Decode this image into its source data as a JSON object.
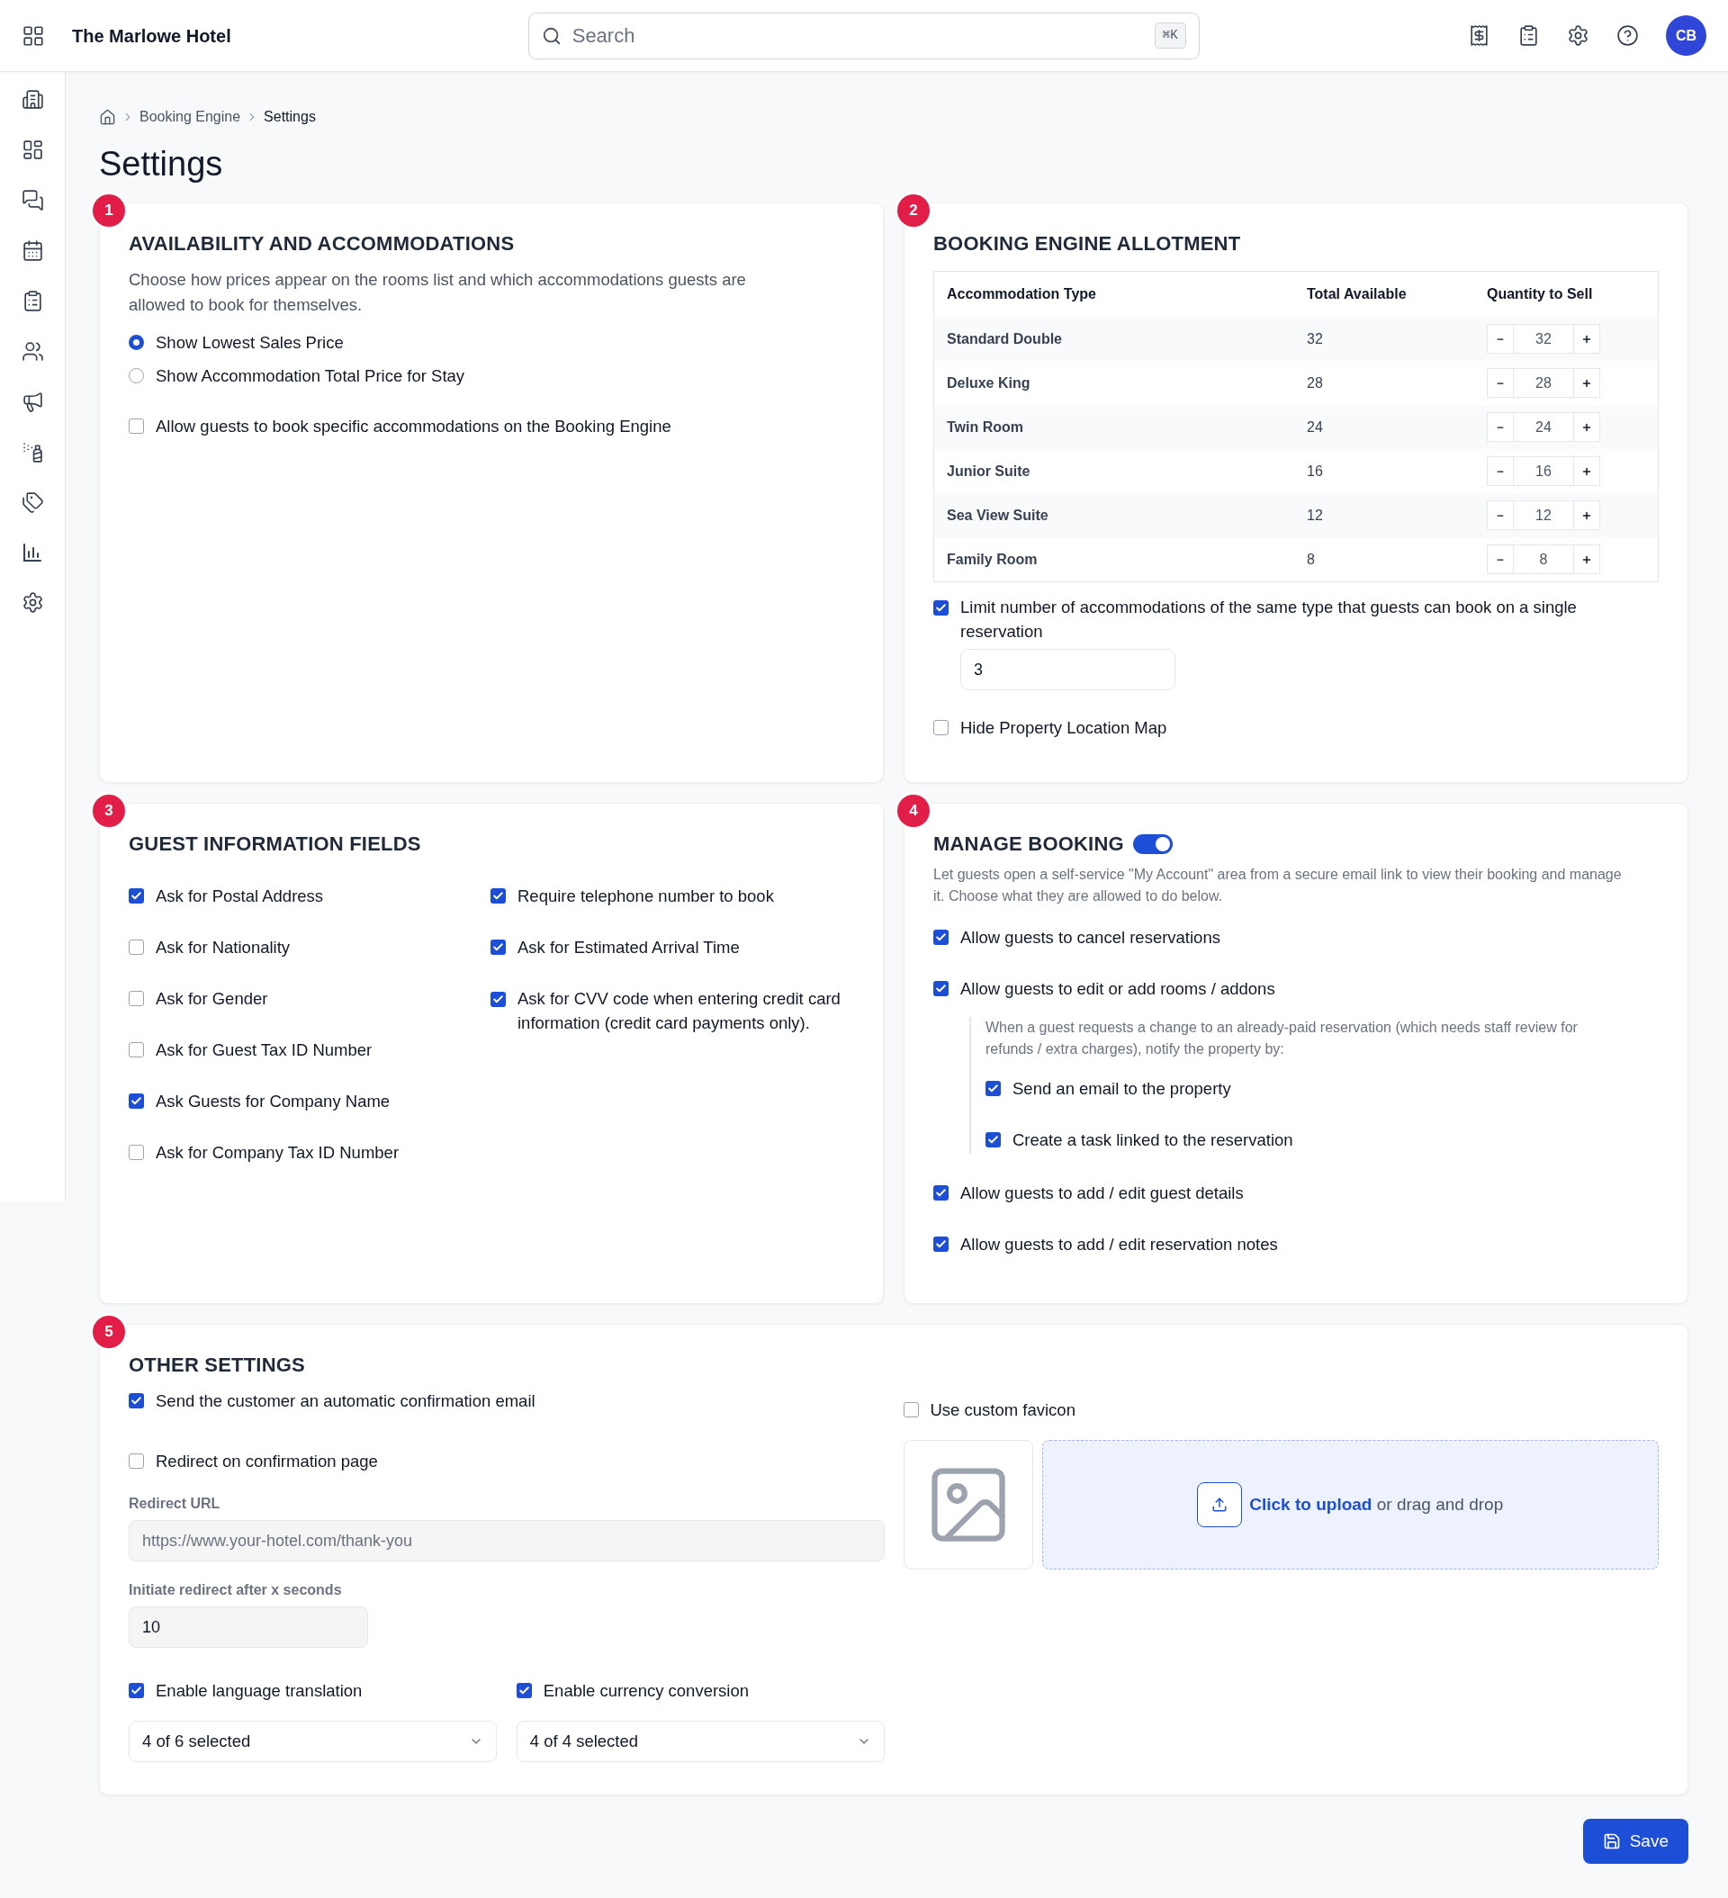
{
  "topbar": {
    "app_title": "The Marlowe Hotel",
    "search": {
      "placeholder": "Search",
      "shortcut": "⌘K"
    },
    "avatar": "CB"
  },
  "breadcrumb": [
    "Booking Engine",
    "Settings"
  ],
  "page_title": "Settings",
  "availability": {
    "number": "1",
    "title": "AVAILABILITY AND ACCOMMODATIONS",
    "description": "Choose how prices appear on the rooms list and which accommodations guests are allowed to book for themselves.",
    "price_options": [
      {
        "label": "Show Lowest Sales Price",
        "selected": true
      },
      {
        "label": "Show Accommodation Total Price for Stay",
        "selected": false
      }
    ],
    "options": [
      {
        "label": "Allow guests to book specific accommodations on the Booking Engine",
        "checked": false
      }
    ]
  },
  "allotment": {
    "number": "2",
    "title": "BOOKING ENGINE ALLOTMENT",
    "columns": [
      "Accommodation Type",
      "Total Available",
      "Quantity to Sell"
    ],
    "rows": [
      {
        "type": "Standard Double",
        "total": "32",
        "quantity": "32"
      },
      {
        "type": "Deluxe King",
        "total": "28",
        "quantity": "28"
      },
      {
        "type": "Twin Room",
        "total": "24",
        "quantity": "24"
      },
      {
        "type": "Junior Suite",
        "total": "16",
        "quantity": "16"
      },
      {
        "type": "Sea View Suite",
        "total": "12",
        "quantity": "12"
      },
      {
        "type": "Family Room",
        "total": "8",
        "quantity": "8"
      }
    ],
    "limit": {
      "label": "Limit number of accommodations of the same type that guests can book on a single reservation",
      "checked": true,
      "value": "3"
    },
    "hide_map": {
      "label": "Hide Property Location Map",
      "checked": false
    }
  },
  "guest_info": {
    "number": "3",
    "title": "GUEST INFORMATION FIELDS",
    "left": [
      {
        "label": "Ask for Postal Address",
        "checked": true
      },
      {
        "label": "Ask for Nationality",
        "checked": false
      },
      {
        "label": "Ask for Gender",
        "checked": false
      },
      {
        "label": "Ask for Guest Tax ID Number",
        "checked": false
      },
      {
        "label": "Ask Guests for Company Name",
        "checked": true
      },
      {
        "label": "Ask for Company Tax ID Number",
        "checked": false
      }
    ],
    "right": [
      {
        "label": "Require telephone number to book",
        "checked": true
      },
      {
        "label": "Ask for Estimated Arrival Time",
        "checked": true
      },
      {
        "label": "Ask for CVV code when entering credit card information (credit card payments only).",
        "checked": true
      }
    ]
  },
  "manage_booking": {
    "number": "4",
    "title": "MANAGE BOOKING",
    "enabled": true,
    "description": "Let guests open a self-service \"My Account\" area from a secure email link to view their booking and manage it. Choose what they are allowed to do below.",
    "options": [
      {
        "label": "Allow guests to cancel reservations",
        "checked": true
      },
      {
        "label": "Allow guests to edit or add rooms / addons",
        "checked": true,
        "notify": {
          "description": "When a guest requests a change to an already-paid reservation (which needs staff review for refunds / extra charges), notify the property by:",
          "options": [
            {
              "label": "Send an email to the property",
              "checked": true
            },
            {
              "label": "Create a task linked to the reservation",
              "checked": true
            }
          ]
        }
      },
      {
        "label": "Allow guests to add / edit guest details",
        "checked": true
      },
      {
        "label": "Allow guests to add / edit reservation notes",
        "checked": true
      }
    ]
  },
  "other": {
    "number": "5",
    "title": "OTHER SETTINGS",
    "confirmation_email": {
      "label": "Send the customer an automatic confirmation email",
      "checked": true
    },
    "redirect": {
      "label": "Redirect on confirmation page",
      "checked": false
    },
    "redirect_url": {
      "label": "Redirect URL",
      "placeholder": "https://www.your-hotel.com/thank-you"
    },
    "redirect_delay": {
      "label": "Initiate redirect after x seconds",
      "value": "10"
    },
    "language": {
      "label": "Enable language translation",
      "checked": true,
      "select": "4 of 6 selected"
    },
    "currency": {
      "label": "Enable currency conversion",
      "checked": true,
      "select": "4 of 4 selected"
    },
    "favicon": {
      "label": "Use custom favicon",
      "checked": false
    },
    "upload": {
      "link": "Click to upload",
      "rest": "or drag and drop"
    }
  },
  "save_button": "Save"
}
